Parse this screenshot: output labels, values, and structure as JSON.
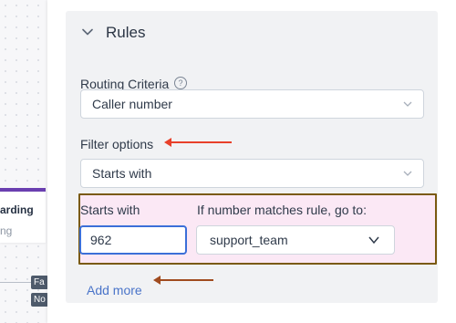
{
  "canvas": {
    "node_title": "arding",
    "node_subtitle": "ng",
    "tags": [
      "Fa",
      "No"
    ]
  },
  "rules": {
    "title": "Rules",
    "routing_criteria_label": "Routing Criteria",
    "help_icon": "?",
    "routing_criteria_value": "Caller number",
    "filter_options_label": "Filter options",
    "filter_options_value": "Starts with",
    "starts_with_label": "Starts with",
    "goto_label": "If number matches rule, go to:",
    "starts_with_value": "962",
    "goto_value": "support_team",
    "add_more": "Add more"
  },
  "colors": {
    "annotation_arrow_red": "#e8402a",
    "annotation_arrow_brown": "#a04b1f",
    "highlight_border": "#7a5a10",
    "link": "#4a74c9"
  },
  "icons": [
    "chevron-down-icon",
    "question-circle-icon",
    "arrow-left-icon"
  ]
}
